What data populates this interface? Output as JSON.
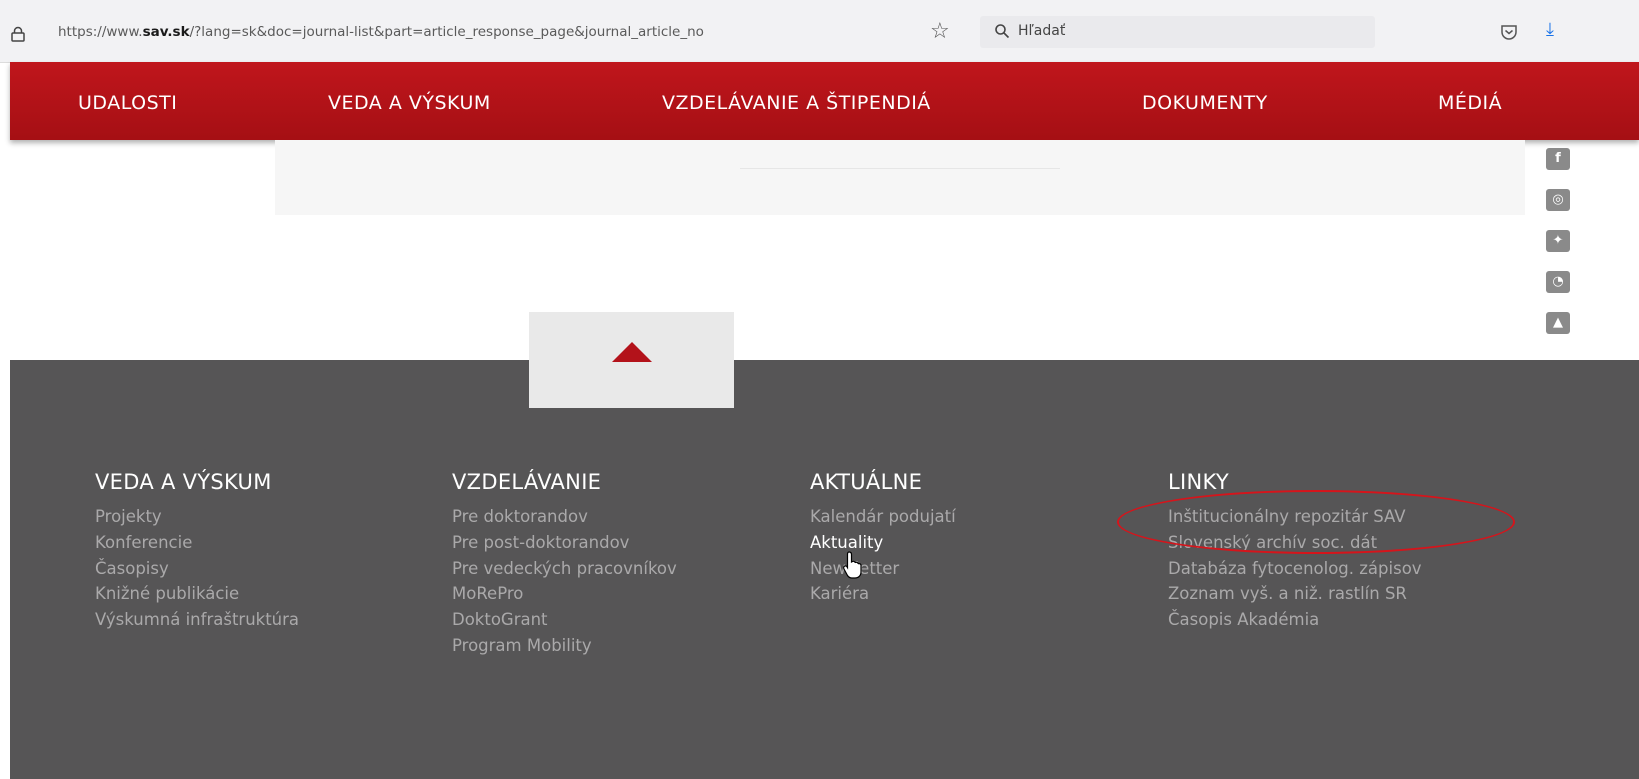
{
  "browser": {
    "url_prefix": "https://www.",
    "url_domain": "sav.sk",
    "url_rest": "/?lang=sk&doc=journal-list&part=article_response_page&journal_article_no",
    "search_placeholder": "Hľadať"
  },
  "nav": {
    "items": [
      "UDALOSTI",
      "VEDA A VÝSKUM",
      "VZDELÁVANIE A ŠTIPENDIÁ",
      "DOKUMENTY",
      "MÉDIÁ"
    ]
  },
  "social": [
    "f",
    "ig",
    "tw",
    "rss",
    "up"
  ],
  "footer": {
    "columns": [
      {
        "title": "VEDA A VÝSKUM",
        "links": [
          "Projekty",
          "Konferencie",
          "Časopisy",
          "Knižné publikácie",
          "Výskumná infraštruktúra"
        ]
      },
      {
        "title": "VZDELÁVANIE",
        "links": [
          "Pre doktorandov",
          "Pre post-doktorandov",
          "Pre vedeckých pracovníkov",
          "MoRePro",
          "DoktoGrant",
          "Program Mobility"
        ]
      },
      {
        "title": "AKTUÁLNE",
        "links": [
          "Kalendár podujatí",
          "Aktuality",
          "Newsletter",
          "Kariéra"
        ]
      },
      {
        "title": "LINKY",
        "links": [
          "Inštitucionálny repozitár SAV",
          "Slovenský archív soc. dát",
          "Databáza fytocenolog. zápisov",
          "Zoznam vyš. a niž. rastlín SR",
          "Časopis Akadémia"
        ]
      }
    ],
    "active_link": "Aktuality",
    "highlighted_link": "Inštitucionálny repozitár SAV"
  },
  "colors": {
    "nav_red": "#b3121a",
    "footer_bg": "#565556",
    "annotation_red": "#d6141b"
  }
}
